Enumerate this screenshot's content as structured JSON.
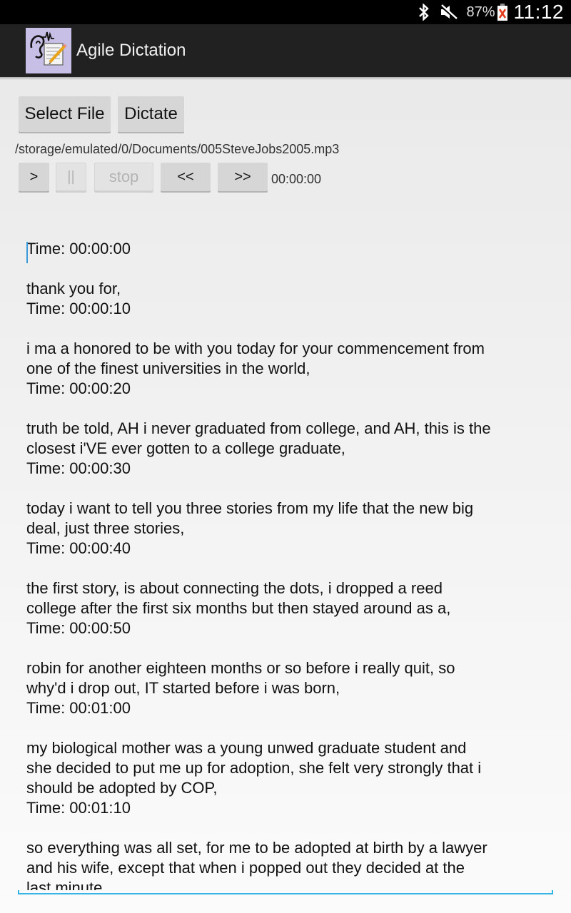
{
  "status_bar": {
    "icons": [
      "bluetooth-icon",
      "mute-icon",
      "battery-icon"
    ],
    "battery_percent": "87%",
    "clock": "11:12"
  },
  "action_bar": {
    "app_icon": "ear-notepad-icon",
    "title": "Agile Dictation"
  },
  "controls": {
    "select_file_label": "Select File",
    "dictate_label": "Dictate",
    "file_path": "/storage/emulated/0/Documents/005SteveJobs2005.mp3",
    "play_label": ">",
    "pause_label": "||",
    "stop_label": "stop",
    "rewind_label": "<<",
    "forward_label": ">>",
    "time_readout": "00:00:00",
    "pause_enabled": false,
    "stop_enabled": false
  },
  "transcript": {
    "lines": [
      "Time: 00:00:00",
      "",
      "thank you for,",
      "Time: 00:00:10",
      "",
      "i ma a honored to be with you today for your commencement from",
      "one of the finest universities in the world,",
      "Time: 00:00:20",
      "",
      "truth be told, AH i never graduated from college, and AH, this is the",
      "closest i'VE ever gotten to a college graduate,",
      "Time: 00:00:30",
      "",
      "today i want to tell you three stories from my life that the new big",
      "deal, just three stories,",
      "Time: 00:00:40",
      "",
      "the first story, is about connecting the dots, i dropped a reed",
      "college after the first six months but then stayed around as a,",
      "Time: 00:00:50",
      "",
      "robin for another eighteen months or so before i really quit, so",
      "why'd i drop out, IT started before i was born,",
      "Time: 00:01:00",
      "",
      "my biological mother was a young unwed graduate student and",
      "she decided to put me up for adoption, she felt very strongly that i",
      "should be adopted by COP,",
      "Time: 00:01:10",
      "",
      "so everything was all set, for me to be adopted at birth by a lawyer",
      "and his wife, except that when i popped out they decided at the",
      "last minute"
    ]
  },
  "colors": {
    "accent": "#33b5e5",
    "action_bar": "#212121",
    "app_icon_bg": "#c8bfe6"
  }
}
